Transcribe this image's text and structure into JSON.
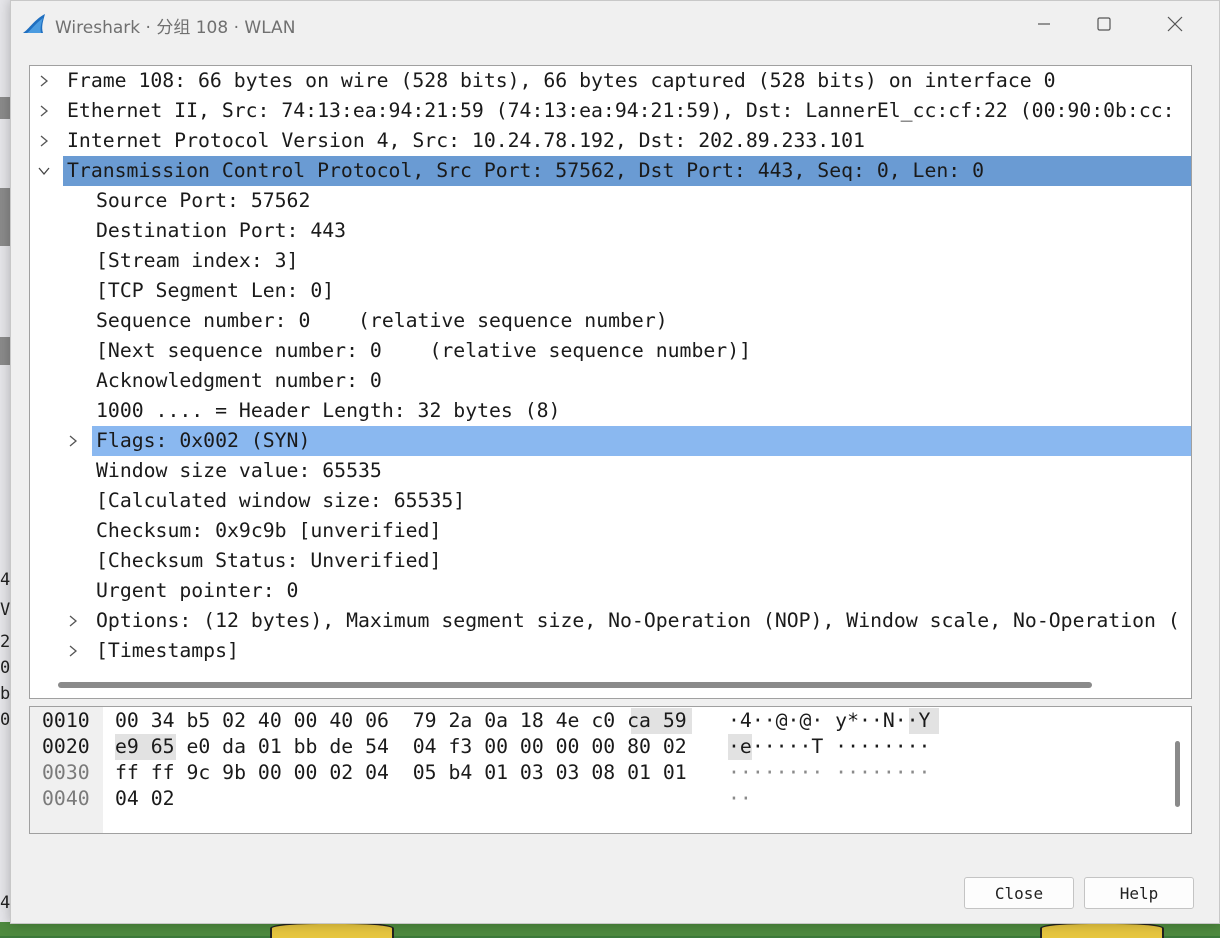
{
  "window": {
    "title": "Wireshark · 分组 108 · WLAN"
  },
  "tree": [
    {
      "indent": 0,
      "arrow": "collapsed",
      "text": "Frame 108: 66 bytes on wire (528 bits), 66 bytes captured (528 bits) on interface 0",
      "state": "normal"
    },
    {
      "indent": 0,
      "arrow": "collapsed",
      "text": "Ethernet II, Src: 74:13:ea:94:21:59 (74:13:ea:94:21:59), Dst: LannerEl_cc:cf:22 (00:90:0b:cc:",
      "state": "normal"
    },
    {
      "indent": 0,
      "arrow": "collapsed",
      "text": "Internet Protocol Version 4, Src: 10.24.78.192, Dst: 202.89.233.101",
      "state": "normal"
    },
    {
      "indent": 0,
      "arrow": "expanded",
      "text": "Transmission Control Protocol, Src Port: 57562, Dst Port: 443, Seq: 0, Len: 0",
      "state": "selected"
    },
    {
      "indent": 1,
      "arrow": "none",
      "text": "Source Port: 57562",
      "state": "normal"
    },
    {
      "indent": 1,
      "arrow": "none",
      "text": "Destination Port: 443",
      "state": "normal"
    },
    {
      "indent": 1,
      "arrow": "none",
      "text": "[Stream index: 3]",
      "state": "normal"
    },
    {
      "indent": 1,
      "arrow": "none",
      "text": "[TCP Segment Len: 0]",
      "state": "normal"
    },
    {
      "indent": 1,
      "arrow": "none",
      "text": "Sequence number: 0    (relative sequence number)",
      "state": "normal"
    },
    {
      "indent": 1,
      "arrow": "none",
      "text": "[Next sequence number: 0    (relative sequence number)]",
      "state": "normal"
    },
    {
      "indent": 1,
      "arrow": "none",
      "text": "Acknowledgment number: 0",
      "state": "normal"
    },
    {
      "indent": 1,
      "arrow": "none",
      "text": "1000 .... = Header Length: 32 bytes (8)",
      "state": "normal"
    },
    {
      "indent": 1,
      "arrow": "collapsed",
      "text": "Flags: 0x002 (SYN)",
      "state": "hilite"
    },
    {
      "indent": 1,
      "arrow": "none",
      "text": "Window size value: 65535",
      "state": "normal"
    },
    {
      "indent": 1,
      "arrow": "none",
      "text": "[Calculated window size: 65535]",
      "state": "normal"
    },
    {
      "indent": 1,
      "arrow": "none",
      "text": "Checksum: 0x9c9b [unverified]",
      "state": "normal"
    },
    {
      "indent": 1,
      "arrow": "none",
      "text": "[Checksum Status: Unverified]",
      "state": "normal"
    },
    {
      "indent": 1,
      "arrow": "none",
      "text": "Urgent pointer: 0",
      "state": "normal"
    },
    {
      "indent": 1,
      "arrow": "collapsed",
      "text": "Options: (12 bytes), Maximum segment size, No-Operation (NOP), Window scale, No-Operation (",
      "state": "normal"
    },
    {
      "indent": 1,
      "arrow": "collapsed",
      "text": "[Timestamps]",
      "state": "normal"
    }
  ],
  "hex": [
    {
      "offset": "0010",
      "bytes": "00 34 b5 02 40 00 40 06  79 2a 0a 18 4e c0 ca 59",
      "ascii": "·4··@·@· y*··N··Y",
      "dim": false
    },
    {
      "offset": "0020",
      "bytes": "e9 65 e0 da 01 bb de 54  04 f3 00 00 00 00 80 02",
      "ascii": "·e·····T ········",
      "dim": false
    },
    {
      "offset": "0030",
      "bytes": "ff ff 9c 9b 00 00 02 04  05 b4 01 03 03 08 01 01",
      "ascii": "········ ········",
      "dim": true
    },
    {
      "offset": "0040",
      "bytes": "04 02",
      "ascii": "··",
      "dim": true
    }
  ],
  "buttons": {
    "close": "Close",
    "help": "Help"
  },
  "background": {
    "left_chars": [
      "4",
      "Ve",
      "2",
      "0",
      "b",
      "0"
    ],
    "bottom_char": "4"
  },
  "colors": {
    "selected_row": "#6a9bd3",
    "highlight_row": "#8ab8f0",
    "hex_highlight": "#e2e2e2"
  }
}
